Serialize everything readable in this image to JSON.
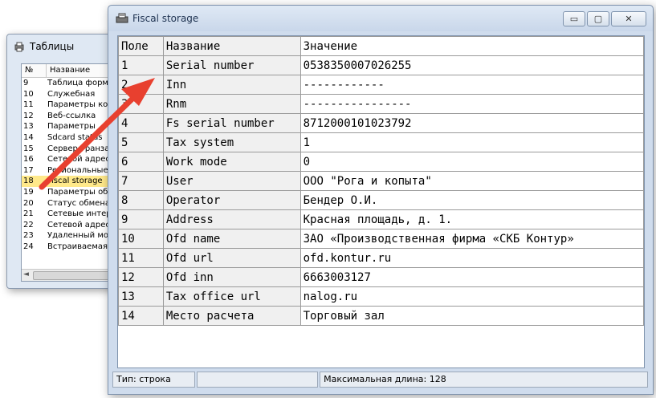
{
  "back_window": {
    "title": "Таблицы",
    "columns": [
      "№",
      "Название"
    ],
    "rows": [
      {
        "num": "9",
        "name": "Таблица форм"
      },
      {
        "num": "10",
        "name": "Служебная"
      },
      {
        "num": "11",
        "name": "Параметры ко"
      },
      {
        "num": "12",
        "name": "Веб-ссылка"
      },
      {
        "num": "13",
        "name": "Параметры"
      },
      {
        "num": "14",
        "name": "Sdcard status"
      },
      {
        "num": "15",
        "name": "Сервер транза"
      },
      {
        "num": "16",
        "name": "Сетевой адрес"
      },
      {
        "num": "17",
        "name": "Региональные"
      },
      {
        "num": "18",
        "name": "Fiscal storage",
        "selected": true
      },
      {
        "num": "19",
        "name": "Параметры об"
      },
      {
        "num": "20",
        "name": "Статус обмена"
      },
      {
        "num": "21",
        "name": "Сетевые интер"
      },
      {
        "num": "22",
        "name": "Сетевой адрес"
      },
      {
        "num": "23",
        "name": "Удаленный мо"
      },
      {
        "num": "24",
        "name": "Встраиваемая"
      }
    ]
  },
  "front_window": {
    "title": "Fiscal storage",
    "controls": {
      "minimize": "▭",
      "maximize": "▢",
      "close": "✕"
    },
    "columns": [
      "Поле",
      "Название",
      "Значение"
    ],
    "rows": [
      {
        "field": "1",
        "name": "Serial number",
        "value": "0538350007026255"
      },
      {
        "field": "2",
        "name": "Inn",
        "value": "------------"
      },
      {
        "field": "3",
        "name": "Rnm",
        "value": "----------------"
      },
      {
        "field": "4",
        "name": "Fs serial number",
        "value": "8712000101023792"
      },
      {
        "field": "5",
        "name": "Tax system",
        "value": "1"
      },
      {
        "field": "6",
        "name": "Work mode",
        "value": "0"
      },
      {
        "field": "7",
        "name": "User",
        "value": "ООО \"Рога и копыта\""
      },
      {
        "field": "8",
        "name": "Operator",
        "value": "Бендер О.И."
      },
      {
        "field": "9",
        "name": "Address",
        "value": "Красная площадь, д. 1."
      },
      {
        "field": "10",
        "name": "Ofd name",
        "value": "ЗАО «Производственная фирма «СКБ Контур»"
      },
      {
        "field": "11",
        "name": "Ofd url",
        "value": "ofd.kontur.ru"
      },
      {
        "field": "12",
        "name": "Ofd inn",
        "value": "6663003127"
      },
      {
        "field": "13",
        "name": "Tax office url",
        "value": "nalog.ru"
      },
      {
        "field": "14",
        "name": "Место расчета",
        "value": "Торговый зал"
      }
    ],
    "status": {
      "type": "Тип: строка",
      "middle": "",
      "max_length": "Максимальная длина: 128"
    }
  },
  "colors": {
    "arrow": "#e8402f",
    "selected_row": "#ffe98a"
  },
  "icons": {
    "back_window": "printer-icon",
    "front_window": "fiscal-device-icon"
  }
}
